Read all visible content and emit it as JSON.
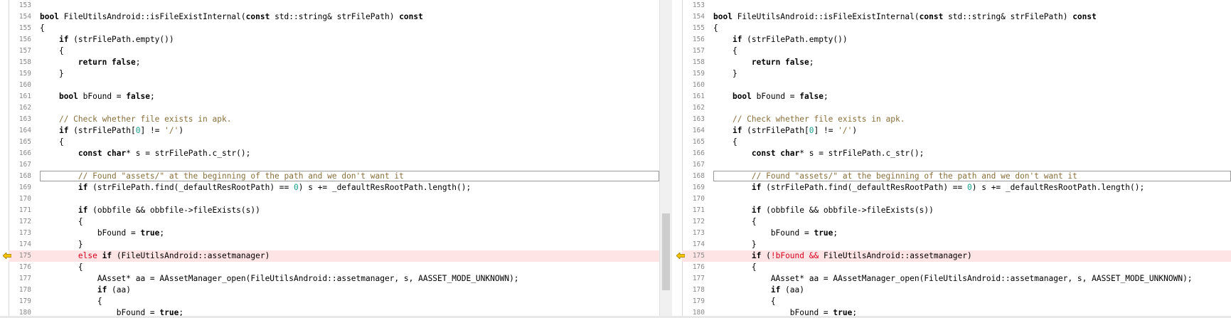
{
  "panes": [
    {
      "id": "left",
      "lines": [
        {
          "n": "153",
          "html": ""
        },
        {
          "n": "154",
          "html": "<span class=\"kw\">bool</span> FileUtilsAndroid::isFileExistInternal(<span class=\"kw\">const</span> std::string&amp; strFilePath) <span class=\"kw\">const</span>"
        },
        {
          "n": "155",
          "html": "{"
        },
        {
          "n": "156",
          "html": "    <span class=\"kw\">if</span> (strFilePath.empty())"
        },
        {
          "n": "157",
          "html": "    {"
        },
        {
          "n": "158",
          "html": "        <span class=\"kw\">return false</span>;"
        },
        {
          "n": "159",
          "html": "    }"
        },
        {
          "n": "160",
          "html": ""
        },
        {
          "n": "161",
          "html": "    <span class=\"kw\">bool</span> bFound = <span class=\"kw\">false</span>;"
        },
        {
          "n": "162",
          "html": ""
        },
        {
          "n": "163",
          "html": "    <span class=\"cm\">// Check whether file exists in apk.</span>"
        },
        {
          "n": "164",
          "html": "    <span class=\"kw\">if</span> (strFilePath[<span class=\"num\">0</span>] != <span class=\"cm\">'/'</span>)"
        },
        {
          "n": "165",
          "html": "    {"
        },
        {
          "n": "166",
          "html": "        <span class=\"kw\">const char</span>* s = strFilePath.c_str();"
        },
        {
          "n": "167",
          "html": ""
        },
        {
          "n": "168",
          "html": "        <span class=\"cm\">// Found \"assets/\" at the beginning of the path and we don't want it</span>",
          "cursor": true
        },
        {
          "n": "169",
          "html": "        <span class=\"kw\">if</span> (strFilePath.find(_defaultResRootPath) == <span class=\"num\">0</span>) s += _defaultResRootPath.length();"
        },
        {
          "n": "170",
          "html": ""
        },
        {
          "n": "171",
          "html": "        <span class=\"kw\">if</span> (obbfile &amp;&amp; obbfile-&gt;fileExists(s))"
        },
        {
          "n": "172",
          "html": "        {"
        },
        {
          "n": "173",
          "html": "            bFound = <span class=\"kw\">true</span>;"
        },
        {
          "n": "174",
          "html": "        }"
        },
        {
          "n": "175",
          "html": "        <span class=\"red\">else</span> <span class=\"kw\">if</span> (FileUtilsAndroid::assetmanager)",
          "diff": true,
          "arrow": true
        },
        {
          "n": "176",
          "html": "        {"
        },
        {
          "n": "177",
          "html": "            AAsset* aa = AAssetManager_open(FileUtilsAndroid::assetmanager, s, AASSET_MODE_UNKNOWN);"
        },
        {
          "n": "178",
          "html": "            <span class=\"kw\">if</span> (aa)"
        },
        {
          "n": "179",
          "html": "            {"
        },
        {
          "n": "180",
          "html": "                bFound = <span class=\"kw\">true</span>;"
        }
      ]
    },
    {
      "id": "right",
      "lines": [
        {
          "n": "153",
          "html": ""
        },
        {
          "n": "154",
          "html": "<span class=\"kw\">bool</span> FileUtilsAndroid::isFileExistInternal(<span class=\"kw\">const</span> std::string&amp; strFilePath) <span class=\"kw\">const</span>"
        },
        {
          "n": "155",
          "html": "{"
        },
        {
          "n": "156",
          "html": "    <span class=\"kw\">if</span> (strFilePath.empty())"
        },
        {
          "n": "157",
          "html": "    {"
        },
        {
          "n": "158",
          "html": "        <span class=\"kw\">return false</span>;"
        },
        {
          "n": "159",
          "html": "    }"
        },
        {
          "n": "160",
          "html": ""
        },
        {
          "n": "161",
          "html": "    <span class=\"kw\">bool</span> bFound = <span class=\"kw\">false</span>;"
        },
        {
          "n": "162",
          "html": ""
        },
        {
          "n": "163",
          "html": "    <span class=\"cm\">// Check whether file exists in apk.</span>"
        },
        {
          "n": "164",
          "html": "    <span class=\"kw\">if</span> (strFilePath[<span class=\"num\">0</span>] != <span class=\"cm\">'/'</span>)"
        },
        {
          "n": "165",
          "html": "    {"
        },
        {
          "n": "166",
          "html": "        <span class=\"kw\">const char</span>* s = strFilePath.c_str();"
        },
        {
          "n": "167",
          "html": ""
        },
        {
          "n": "168",
          "html": "        <span class=\"cm\">// Found \"assets/\" at the beginning of the path and we don't want it</span>",
          "cursor": true
        },
        {
          "n": "169",
          "html": "        <span class=\"kw\">if</span> (strFilePath.find(_defaultResRootPath) == <span class=\"num\">0</span>) s += _defaultResRootPath.length();"
        },
        {
          "n": "170",
          "html": ""
        },
        {
          "n": "171",
          "html": "        <span class=\"kw\">if</span> (obbfile &amp;&amp; obbfile-&gt;fileExists(s))"
        },
        {
          "n": "172",
          "html": "        {"
        },
        {
          "n": "173",
          "html": "            bFound = <span class=\"kw\">true</span>;"
        },
        {
          "n": "174",
          "html": "        }"
        },
        {
          "n": "175",
          "html": "        <span class=\"kw\">if</span> (<span class=\"red\">!bFound &amp;&amp;</span> FileUtilsAndroid::assetmanager)",
          "diff": true,
          "arrow": true
        },
        {
          "n": "176",
          "html": "        {"
        },
        {
          "n": "177",
          "html": "            AAsset* aa = AAssetManager_open(FileUtilsAndroid::assetmanager, s, AASSET_MODE_UNKNOWN);"
        },
        {
          "n": "178",
          "html": "            <span class=\"kw\">if</span> (aa)"
        },
        {
          "n": "179",
          "html": "            {"
        },
        {
          "n": "180",
          "html": "                bFound = <span class=\"kw\">true</span>;"
        }
      ]
    }
  ],
  "icons": {
    "diff_arrow": "arrow-left-icon"
  },
  "colors": {
    "diff_bg": "#ffe4e6",
    "comment": "#8a6f3a",
    "number": "#17a08f",
    "changed": "#d6001c",
    "arrow": "#f5c400"
  }
}
